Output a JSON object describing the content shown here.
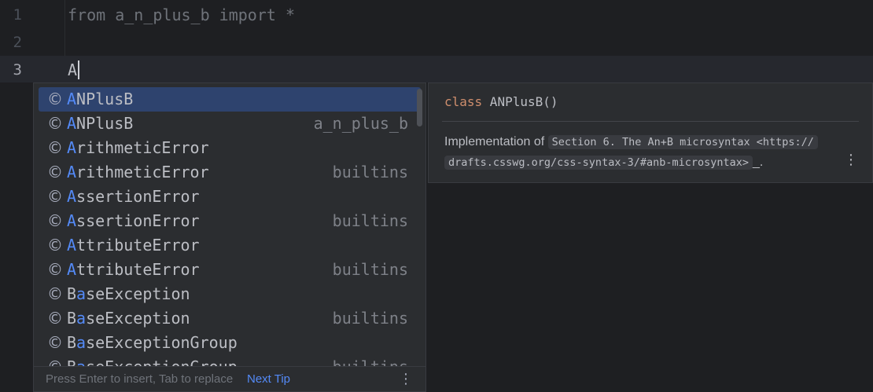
{
  "editor": {
    "lines": [
      {
        "number": "1",
        "code": "from a_n_plus_b import *"
      },
      {
        "number": "2",
        "code": ""
      },
      {
        "number": "3",
        "code": "A"
      }
    ]
  },
  "completion": {
    "items": [
      {
        "icon": "class-icon",
        "glyph": "©",
        "match": "A",
        "rest": "NPlusB",
        "module": ""
      },
      {
        "icon": "class-icon",
        "glyph": "©",
        "match": "A",
        "rest": "NPlusB",
        "module": "a_n_plus_b"
      },
      {
        "icon": "class-icon",
        "glyph": "©",
        "match": "A",
        "rest": "rithmeticError",
        "module": ""
      },
      {
        "icon": "class-icon",
        "glyph": "©",
        "match": "A",
        "rest": "rithmeticError",
        "module": "builtins"
      },
      {
        "icon": "class-icon",
        "glyph": "©",
        "match": "A",
        "rest": "ssertionError",
        "module": ""
      },
      {
        "icon": "class-icon",
        "glyph": "©",
        "match": "A",
        "rest": "ssertionError",
        "module": "builtins"
      },
      {
        "icon": "class-icon",
        "glyph": "©",
        "match": "A",
        "rest": "ttributeError",
        "module": ""
      },
      {
        "icon": "class-icon",
        "glyph": "©",
        "match": "A",
        "rest": "ttributeError",
        "module": "builtins"
      },
      {
        "icon": "class-icon",
        "glyph": "©",
        "prefix": "B",
        "match": "a",
        "rest": "seException",
        "module": ""
      },
      {
        "icon": "class-icon",
        "glyph": "©",
        "prefix": "B",
        "match": "a",
        "rest": "seException",
        "module": "builtins"
      },
      {
        "icon": "class-icon",
        "glyph": "©",
        "prefix": "B",
        "match": "a",
        "rest": "seExceptionGroup",
        "module": ""
      },
      {
        "icon": "class-icon",
        "glyph": "©",
        "prefix": "B",
        "match": "a",
        "rest": "seExceptionGroup",
        "module": "builtins"
      }
    ],
    "footer": {
      "hint": "Press Enter to insert, Tab to replace",
      "link": "Next Tip",
      "menu_glyph": "⋮"
    }
  },
  "doc": {
    "keyword": "class",
    "signature": " ANPlusB()",
    "intro": "Implementation of ",
    "code_line1": "Section 6. The An+B microsyntax <https://",
    "code_line2": "drafts.csswg.org/css-syntax-3/#anb-microsyntax>",
    "trailing": "_.",
    "menu_glyph": "⋮"
  }
}
